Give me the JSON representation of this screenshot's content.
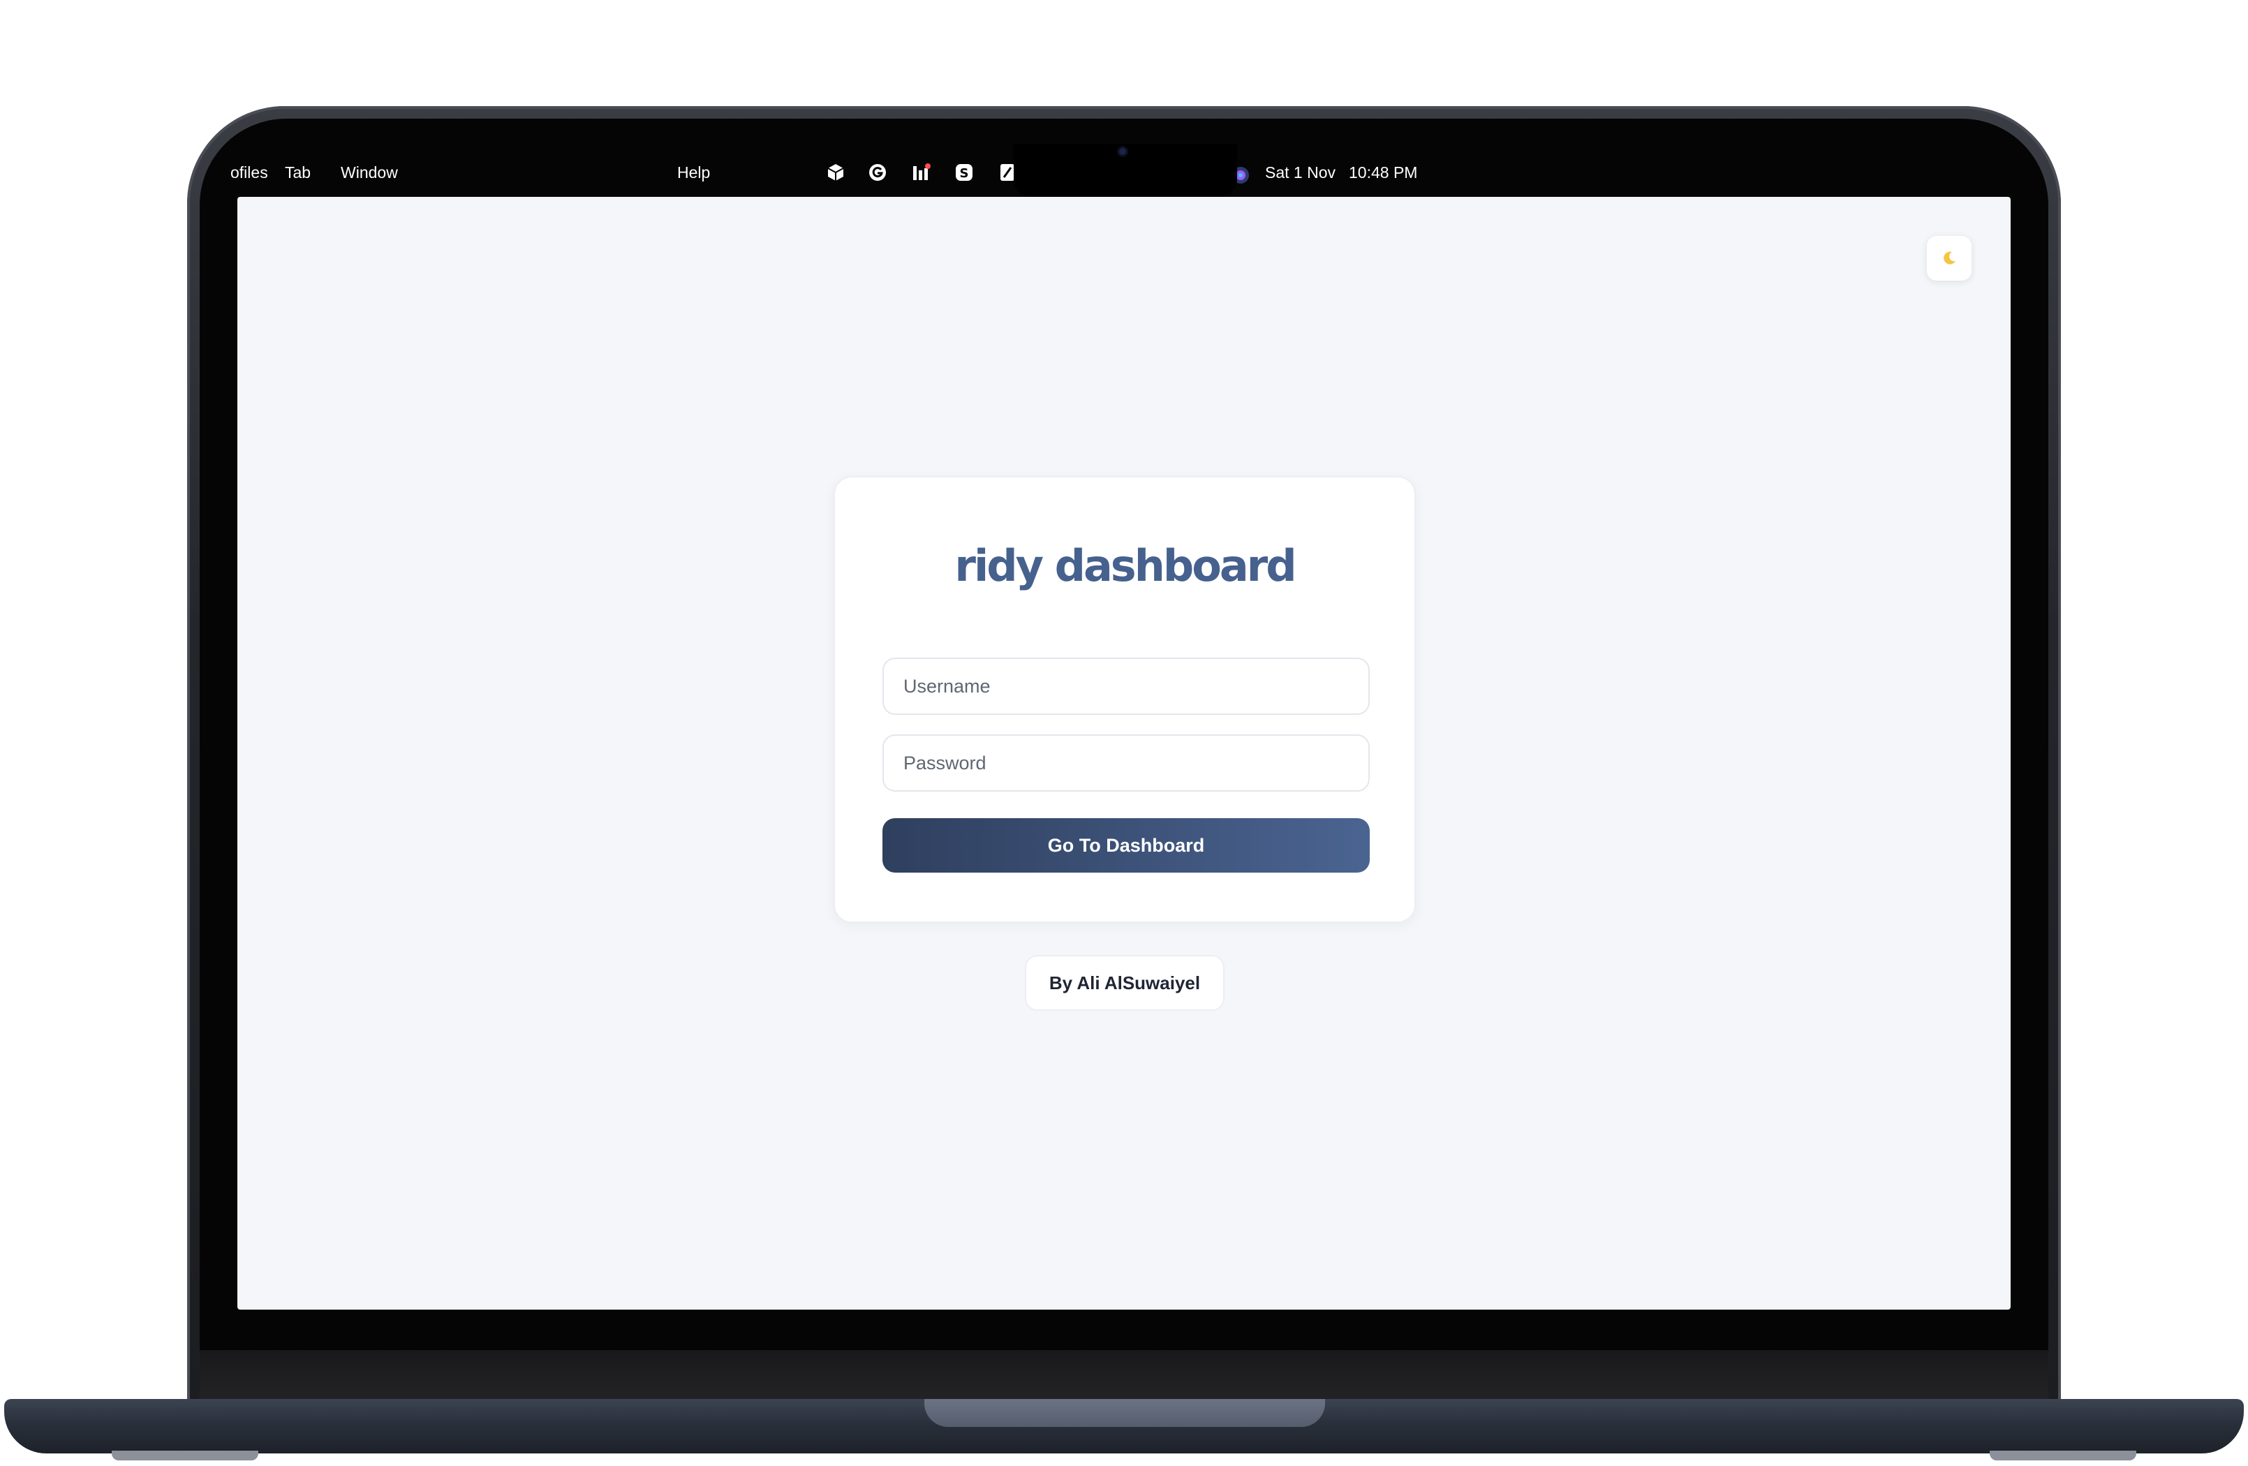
{
  "menubar": {
    "items": [
      "ofiles",
      "Tab",
      "Window",
      "Help"
    ],
    "tray_icons": [
      "box-icon",
      "grammarly-icon",
      "chart-icon",
      "skype-icon",
      "document-icon",
      "siri-icon"
    ],
    "date": "Sat 1 Nov",
    "time": "10:48 PM"
  },
  "login": {
    "brand": "ridy dashboard",
    "username_placeholder": "Username",
    "password_placeholder": "Password",
    "submit_label": "Go To Dashboard"
  },
  "footer": {
    "credit": "By Ali AlSuwaiyel"
  },
  "colors": {
    "brand": "#46618e",
    "button_gradient_start": "#2f3f5e",
    "button_gradient_end": "#4a6491",
    "background": "#f5f6f9"
  }
}
